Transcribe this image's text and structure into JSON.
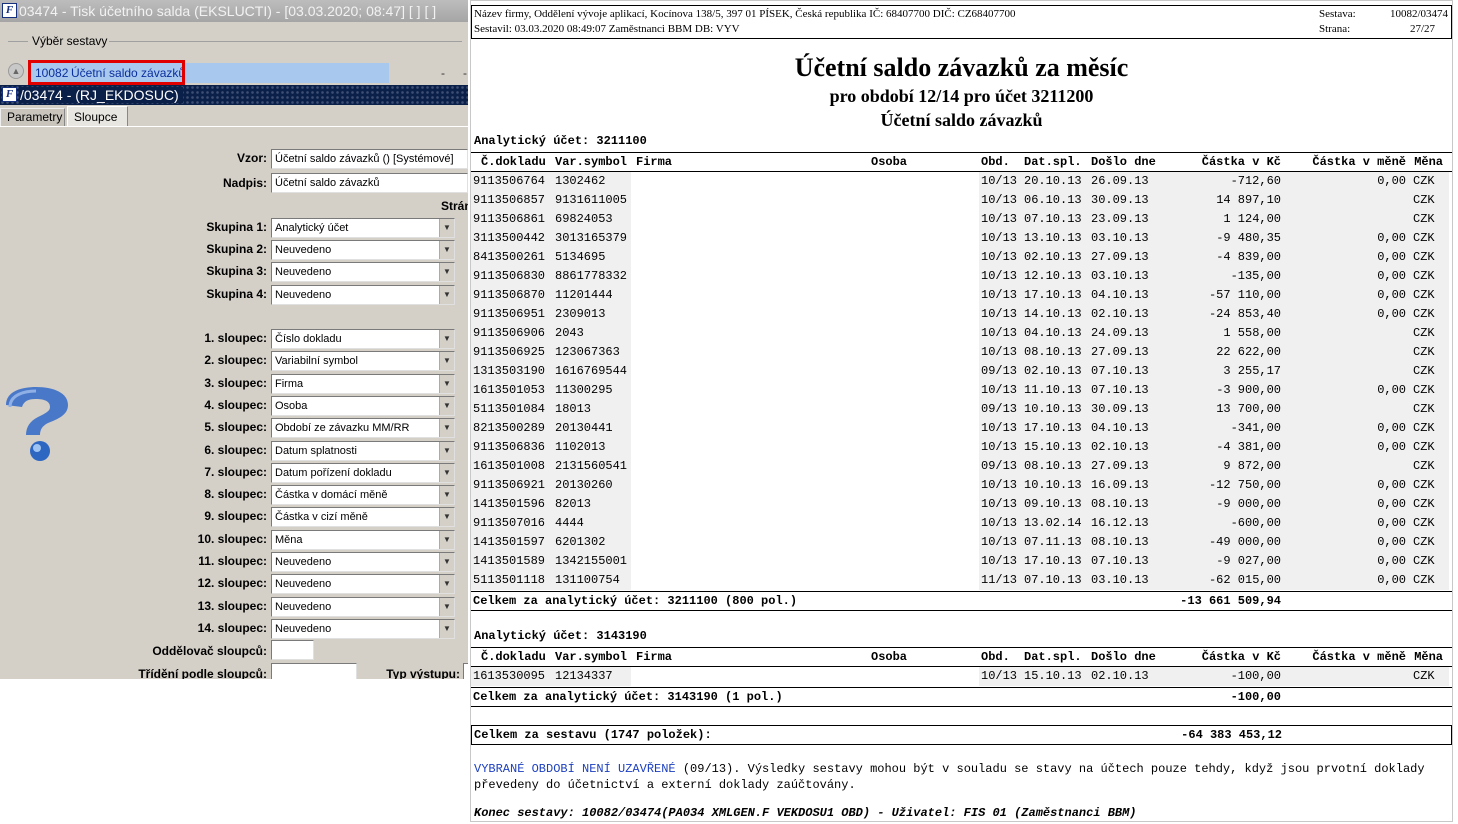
{
  "left": {
    "title": "03474 - Tisk účetního salda (EKSLUCTI) - [03.03.2020; 08:47]  [ ]  [ ]",
    "group_label": "Výběr sestavy",
    "selected": {
      "code": "10082",
      "name": "Účetní saldo závazků"
    },
    "dash": "-",
    "subwindow_title": "/03474 - (RJ_EKDOSUC)",
    "tabs": [
      "Parametry",
      "Sloupce"
    ],
    "vzor_label": "Vzor:",
    "vzor_value": "Účetní saldo závazků   ()   [Systémové]",
    "nadpis_label": "Nadpis:",
    "nadpis_value": "Účetní saldo závazků",
    "strana_label": "Strán",
    "groups": [
      {
        "label": "Skupina 1:",
        "value": "Analytický účet"
      },
      {
        "label": "Skupina 2:",
        "value": "Neuvedeno"
      },
      {
        "label": "Skupina 3:",
        "value": "Neuvedeno"
      },
      {
        "label": "Skupina 4:",
        "value": "Neuvedeno"
      }
    ],
    "columns": [
      {
        "label": "1. sloupec:",
        "value": "Číslo dokladu"
      },
      {
        "label": "2. sloupec:",
        "value": "Variabilní symbol"
      },
      {
        "label": "3. sloupec:",
        "value": "Firma"
      },
      {
        "label": "4. sloupec:",
        "value": "Osoba"
      },
      {
        "label": "5. sloupec:",
        "value": "Období ze závazku MM/RR"
      },
      {
        "label": "6. sloupec:",
        "value": "Datum splatnosti"
      },
      {
        "label": "7. sloupec:",
        "value": "Datum pořízení dokladu"
      },
      {
        "label": "8. sloupec:",
        "value": "Částka v domácí měně"
      },
      {
        "label": "9. sloupec:",
        "value": "Částka v cizí měně"
      },
      {
        "label": "10. sloupec:",
        "value": "Měna"
      },
      {
        "label": "11. sloupec:",
        "value": "Neuvedeno"
      },
      {
        "label": "12. sloupec:",
        "value": "Neuvedeno"
      },
      {
        "label": "13. sloupec:",
        "value": "Neuvedeno"
      },
      {
        "label": "14. sloupec:",
        "value": "Neuvedeno"
      }
    ],
    "separator_label": "Oddělovač sloupců:",
    "separator_value": "",
    "sort_label": "Třídění podle sloupců:",
    "sort_value": "",
    "output_label": "Typ výstupu:"
  },
  "report": {
    "company": "Název firmy, Oddělení vývoje aplikací, Kocínova 138/5, 397 01 PÍSEK, Česká republika  IČ: 68407700  DIČ: CZ68407700",
    "compiled": "Sestavil: 03.03.2020 08:49:07 Zaměstnanci BBM  DB: VYV",
    "sestava_label": "Sestava:",
    "sestava_value": "10082/03474",
    "strana_label": "Strana:",
    "strana_value": "27/27",
    "title": "Účetní saldo závazků za měsíc",
    "subtitle": "pro období 12/14 pro účet 3211200",
    "subtitle2": "Účetní saldo závazků",
    "headers": [
      "Č.dokladu",
      "Var.symbol",
      "Firma",
      "Osoba",
      "Obd.",
      "Dat.spl.",
      "Došlo dne",
      "Částka v Kč",
      "Částka v měně",
      "Měna"
    ],
    "sections": [
      {
        "label": "Analytický účet: 3211100",
        "rows": [
          [
            "9113506764",
            "1302462",
            "10/13",
            "20.10.13",
            "26.09.13",
            "-712,60",
            "0,00",
            "CZK"
          ],
          [
            "9113506857",
            "9131611005",
            "10/13",
            "06.10.13",
            "30.09.13",
            "14 897,10",
            "",
            "CZK"
          ],
          [
            "9113506861",
            "69824053",
            "10/13",
            "07.10.13",
            "23.09.13",
            "1 124,00",
            "",
            "CZK"
          ],
          [
            "3113500442",
            "3013165379",
            "10/13",
            "13.10.13",
            "03.10.13",
            "-9 480,35",
            "0,00",
            "CZK"
          ],
          [
            "8413500261",
            "5134695",
            "10/13",
            "02.10.13",
            "27.09.13",
            "-4 839,00",
            "0,00",
            "CZK"
          ],
          [
            "9113506830",
            "8861778332",
            "10/13",
            "12.10.13",
            "03.10.13",
            "-135,00",
            "0,00",
            "CZK"
          ],
          [
            "9113506870",
            "11201444",
            "10/13",
            "17.10.13",
            "04.10.13",
            "-57 110,00",
            "0,00",
            "CZK"
          ],
          [
            "9113506951",
            "2309013",
            "10/13",
            "14.10.13",
            "02.10.13",
            "-24 853,40",
            "0,00",
            "CZK"
          ],
          [
            "9113506906",
            "2043",
            "10/13",
            "04.10.13",
            "24.09.13",
            "1 558,00",
            "",
            "CZK"
          ],
          [
            "9113506925",
            "123067363",
            "10/13",
            "08.10.13",
            "27.09.13",
            "22 622,00",
            "",
            "CZK"
          ],
          [
            "1313503190",
            "1616769544",
            "09/13",
            "02.10.13",
            "07.10.13",
            "3 255,17",
            "",
            "CZK"
          ],
          [
            "1613501053",
            "11300295",
            "10/13",
            "11.10.13",
            "07.10.13",
            "-3 900,00",
            "0,00",
            "CZK"
          ],
          [
            "5113501084",
            "18013",
            "09/13",
            "10.10.13",
            "30.09.13",
            "13 700,00",
            "",
            "CZK"
          ],
          [
            "8213500289",
            "20130441",
            "10/13",
            "17.10.13",
            "04.10.13",
            "-341,00",
            "0,00",
            "CZK"
          ],
          [
            "9113506836",
            "1102013",
            "10/13",
            "15.10.13",
            "02.10.13",
            "-4 381,00",
            "0,00",
            "CZK"
          ],
          [
            "1613501008",
            "2131560541",
            "09/13",
            "08.10.13",
            "27.09.13",
            "9 872,00",
            "",
            "CZK"
          ],
          [
            "9113506921",
            "20130260",
            "10/13",
            "10.10.13",
            "16.09.13",
            "-12 750,00",
            "0,00",
            "CZK"
          ],
          [
            "1413501596",
            "82013",
            "10/13",
            "09.10.13",
            "08.10.13",
            "-9 000,00",
            "0,00",
            "CZK"
          ],
          [
            "9113507016",
            "4444",
            "10/13",
            "13.02.14",
            "16.12.13",
            "-600,00",
            "0,00",
            "CZK"
          ],
          [
            "1413501597",
            "6201302",
            "10/13",
            "07.11.13",
            "08.10.13",
            "-49 000,00",
            "0,00",
            "CZK"
          ],
          [
            "1413501589",
            "1342155001",
            "10/13",
            "17.10.13",
            "07.10.13",
            "-9 027,00",
            "0,00",
            "CZK"
          ],
          [
            "5113501118",
            "131100754",
            "11/13",
            "07.10.13",
            "03.10.13",
            "-62 015,00",
            "0,00",
            "CZK"
          ]
        ],
        "total_label": "Celkem za analytický účet: 3211100 (800 pol.)",
        "total_value": "-13 661 509,94"
      },
      {
        "label": "Analytický účet: 3143190",
        "rows": [
          [
            "1613530095",
            "12134337",
            "10/13",
            "15.10.13",
            "02.10.13",
            "-100,00",
            "",
            "CZK"
          ]
        ],
        "total_label": "Celkem za analytický účet: 3143190 (1 pol.)",
        "total_value": "-100,00"
      }
    ],
    "grand_total_label": "Celkem za sestavu (1747 položek):",
    "grand_total_value": "-64 383 453,12",
    "note_highlight": "VYBRANÉ OBDOBÍ NENÍ UZAVŘENÉ",
    "note_text": " (09/13). Výsledky sestavy mohou být v souladu se stavy na účtech pouze tehdy, když jsou prvotní doklady převedeny do účetnictví a externí doklady zaúčtovány.",
    "footer": "Konec sestavy: 10082/03474(PA034 XMLGEN.F VEKDOSU1 OBD) - Uživatel: FIS 01 (Zaměstnanci BBM)"
  }
}
